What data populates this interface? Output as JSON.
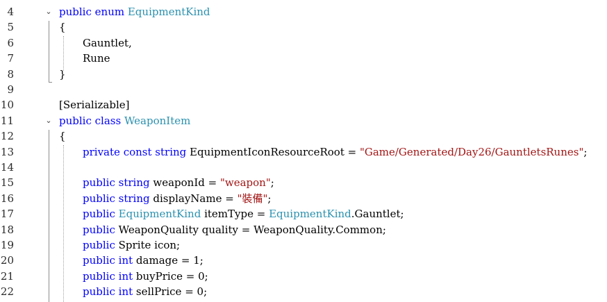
{
  "editor": {
    "lines": [
      {
        "num": "4",
        "fold": "⌄",
        "indent": 0,
        "tokens": [
          {
            "t": "public",
            "c": "kw"
          },
          {
            "t": " "
          },
          {
            "t": "enum",
            "c": "kw"
          },
          {
            "t": " "
          },
          {
            "t": "EquipmentKind",
            "c": "type"
          }
        ]
      },
      {
        "num": "5",
        "indent": 0,
        "tokens": [
          {
            "t": "{"
          }
        ]
      },
      {
        "num": "6",
        "indent": 1,
        "tokens": [
          {
            "t": "Gauntlet,"
          }
        ]
      },
      {
        "num": "7",
        "indent": 1,
        "tokens": [
          {
            "t": "Rune"
          }
        ]
      },
      {
        "num": "8",
        "indent": 0,
        "tokens": [
          {
            "t": "}"
          }
        ]
      },
      {
        "num": "9",
        "indent": 0,
        "tokens": []
      },
      {
        "num": "10",
        "indent": 0,
        "tokens": [
          {
            "t": "[Serializable]"
          }
        ]
      },
      {
        "num": "11",
        "fold": "⌄",
        "indent": 0,
        "tokens": [
          {
            "t": "public",
            "c": "kw"
          },
          {
            "t": " "
          },
          {
            "t": "class",
            "c": "kw"
          },
          {
            "t": " "
          },
          {
            "t": "WeaponItem",
            "c": "type"
          }
        ]
      },
      {
        "num": "12",
        "indent": 0,
        "tokens": [
          {
            "t": "{"
          }
        ]
      },
      {
        "num": "13",
        "indent": 1,
        "tokens": [
          {
            "t": "private",
            "c": "kw"
          },
          {
            "t": " "
          },
          {
            "t": "const",
            "c": "kw"
          },
          {
            "t": " "
          },
          {
            "t": "string",
            "c": "kw"
          },
          {
            "t": " EquipmentIconResourceRoot = "
          },
          {
            "t": "\"Game/Generated/Day26/GauntletsRunes\"",
            "c": "str"
          },
          {
            "t": ";"
          }
        ]
      },
      {
        "num": "14",
        "indent": 1,
        "tokens": []
      },
      {
        "num": "15",
        "indent": 1,
        "tokens": [
          {
            "t": "public",
            "c": "kw"
          },
          {
            "t": " "
          },
          {
            "t": "string",
            "c": "kw"
          },
          {
            "t": " weaponId = "
          },
          {
            "t": "\"weapon\"",
            "c": "str"
          },
          {
            "t": ";"
          }
        ]
      },
      {
        "num": "16",
        "indent": 1,
        "tokens": [
          {
            "t": "public",
            "c": "kw"
          },
          {
            "t": " "
          },
          {
            "t": "string",
            "c": "kw"
          },
          {
            "t": " displayName = "
          },
          {
            "t": "\"裝備\"",
            "c": "str"
          },
          {
            "t": ";"
          }
        ]
      },
      {
        "num": "17",
        "indent": 1,
        "tokens": [
          {
            "t": "public",
            "c": "kw"
          },
          {
            "t": " "
          },
          {
            "t": "EquipmentKind",
            "c": "type"
          },
          {
            "t": " itemType = "
          },
          {
            "t": "EquipmentKind",
            "c": "type"
          },
          {
            "t": ".Gauntlet;"
          }
        ]
      },
      {
        "num": "18",
        "indent": 1,
        "tokens": [
          {
            "t": "public",
            "c": "kw"
          },
          {
            "t": " WeaponQuality quality = WeaponQuality.Common;"
          }
        ]
      },
      {
        "num": "19",
        "indent": 1,
        "tokens": [
          {
            "t": "public",
            "c": "kw"
          },
          {
            "t": " Sprite icon;"
          }
        ]
      },
      {
        "num": "20",
        "indent": 1,
        "tokens": [
          {
            "t": "public",
            "c": "kw"
          },
          {
            "t": " "
          },
          {
            "t": "int",
            "c": "kw"
          },
          {
            "t": " damage = 1;"
          }
        ]
      },
      {
        "num": "21",
        "indent": 1,
        "tokens": [
          {
            "t": "public",
            "c": "kw"
          },
          {
            "t": " "
          },
          {
            "t": "int",
            "c": "kw"
          },
          {
            "t": " buyPrice = 0;"
          }
        ]
      },
      {
        "num": "22",
        "indent": 1,
        "tokens": [
          {
            "t": "public",
            "c": "kw"
          },
          {
            "t": " "
          },
          {
            "t": "int",
            "c": "kw"
          },
          {
            "t": " sellPrice = 0;"
          }
        ]
      }
    ]
  }
}
